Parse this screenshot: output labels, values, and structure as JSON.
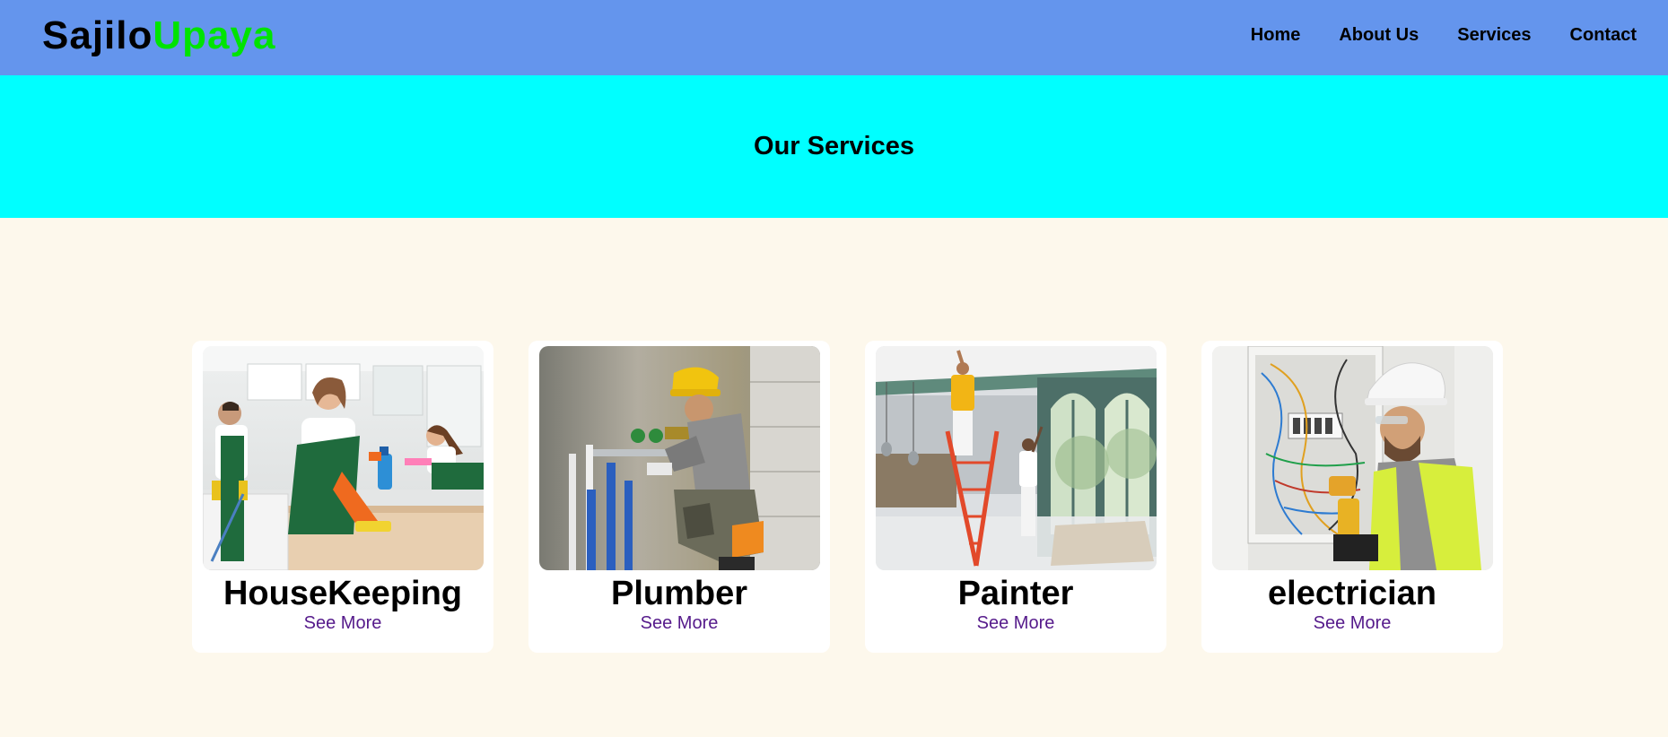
{
  "brand": {
    "part1": "Sajilo",
    "part2": "Upaya"
  },
  "nav": {
    "items": [
      {
        "label": "Home"
      },
      {
        "label": "About Us"
      },
      {
        "label": "Services"
      },
      {
        "label": "Contact"
      }
    ]
  },
  "hero": {
    "title": "Our Services"
  },
  "services": [
    {
      "title": "HouseKeeping",
      "link_label": "See More",
      "image": "housekeeping-photo"
    },
    {
      "title": "Plumber",
      "link_label": "See More",
      "image": "plumber-photo"
    },
    {
      "title": "Painter",
      "link_label": "See More",
      "image": "painter-photo"
    },
    {
      "title": "electrician",
      "link_label": "See More",
      "image": "electrician-photo"
    }
  ],
  "colors": {
    "navbar_bg": "#6495ed",
    "hero_bg": "#00ffff",
    "page_bg": "#fdf8ec",
    "brand_accent": "#00e400",
    "link": "#551a8b"
  }
}
